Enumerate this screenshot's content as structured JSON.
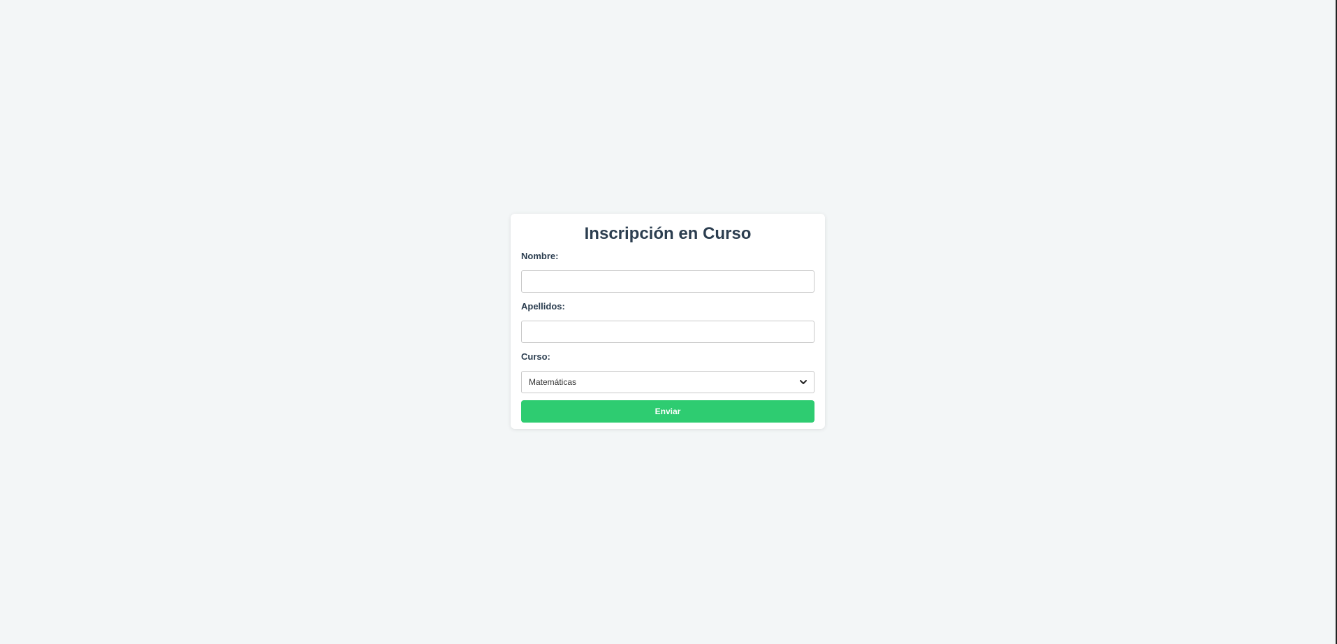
{
  "form": {
    "title": "Inscripción en Curso",
    "fields": {
      "nombre": {
        "label": "Nombre:",
        "value": "",
        "placeholder": ""
      },
      "apellidos": {
        "label": "Apellidos:",
        "value": "",
        "placeholder": ""
      },
      "curso": {
        "label": "Curso:",
        "selected": "Matemáticas"
      }
    },
    "submit_label": "Enviar"
  },
  "colors": {
    "background": "#f3f6f7",
    "card": "#ffffff",
    "text": "#2c3e50",
    "submit": "#2ecc71"
  },
  "icons": {
    "select": "chevron-down-icon"
  }
}
